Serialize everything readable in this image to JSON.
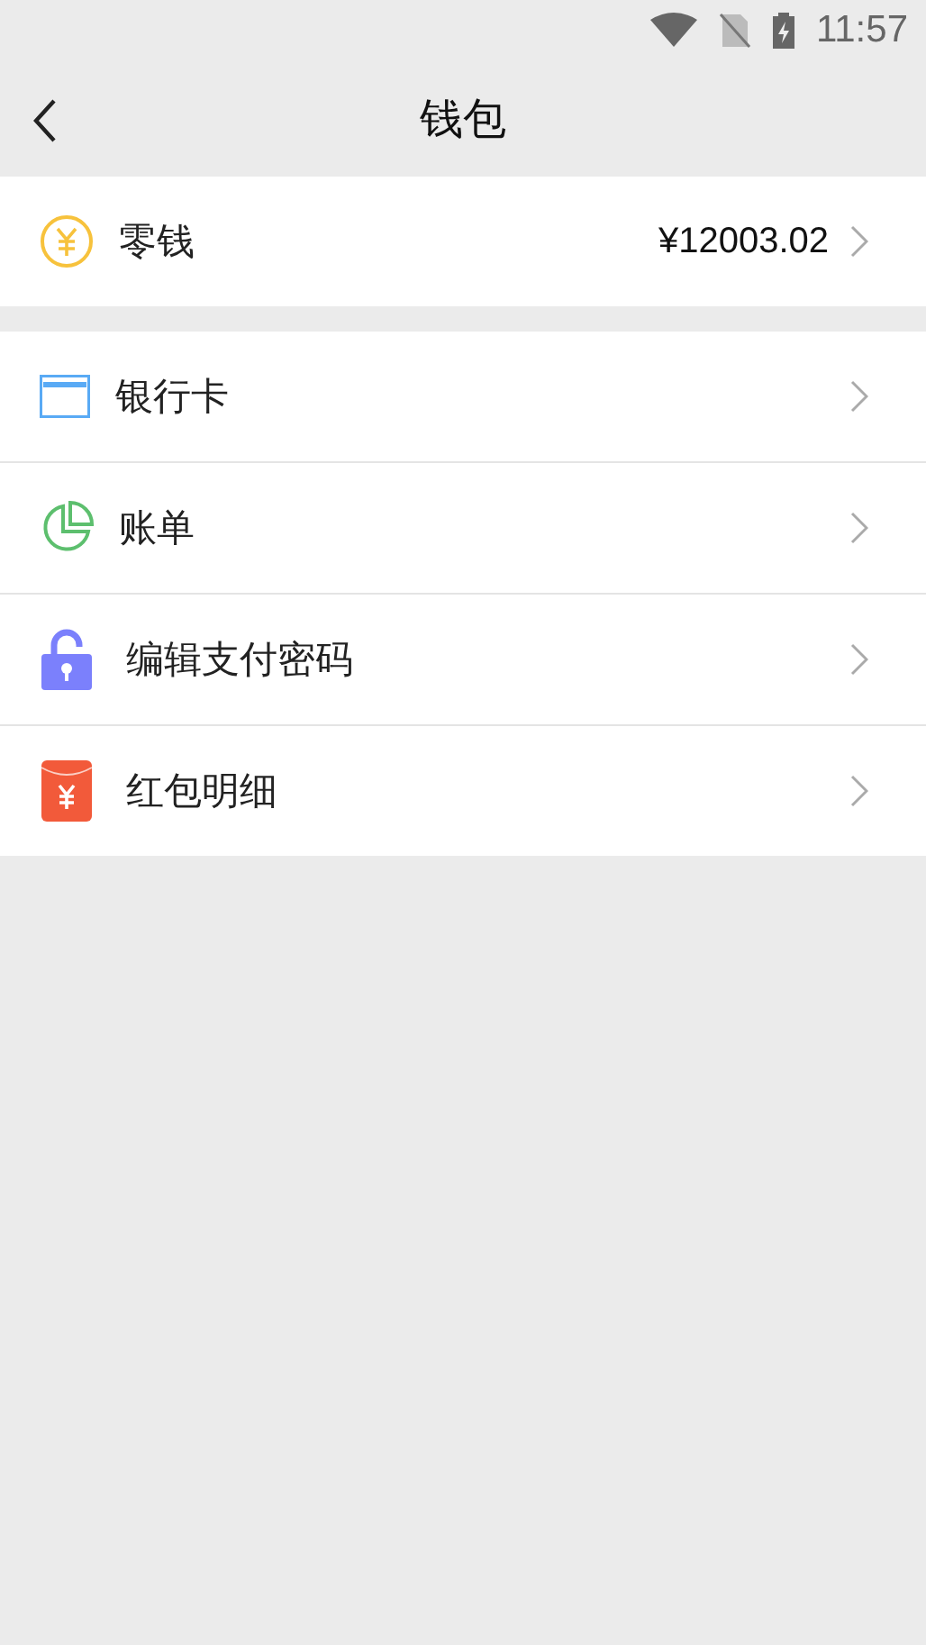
{
  "status_bar": {
    "time": "11:57"
  },
  "header": {
    "title": "钱包"
  },
  "sections": [
    {
      "rows": [
        {
          "kind": "coin",
          "label": "零钱",
          "value": "¥12003.02"
        }
      ]
    },
    {
      "rows": [
        {
          "kind": "card",
          "label": "银行卡"
        },
        {
          "kind": "chart",
          "label": "账单"
        },
        {
          "kind": "lock",
          "label": "编辑支付密码"
        },
        {
          "kind": "redpacket",
          "label": "红包明细"
        }
      ]
    }
  ]
}
